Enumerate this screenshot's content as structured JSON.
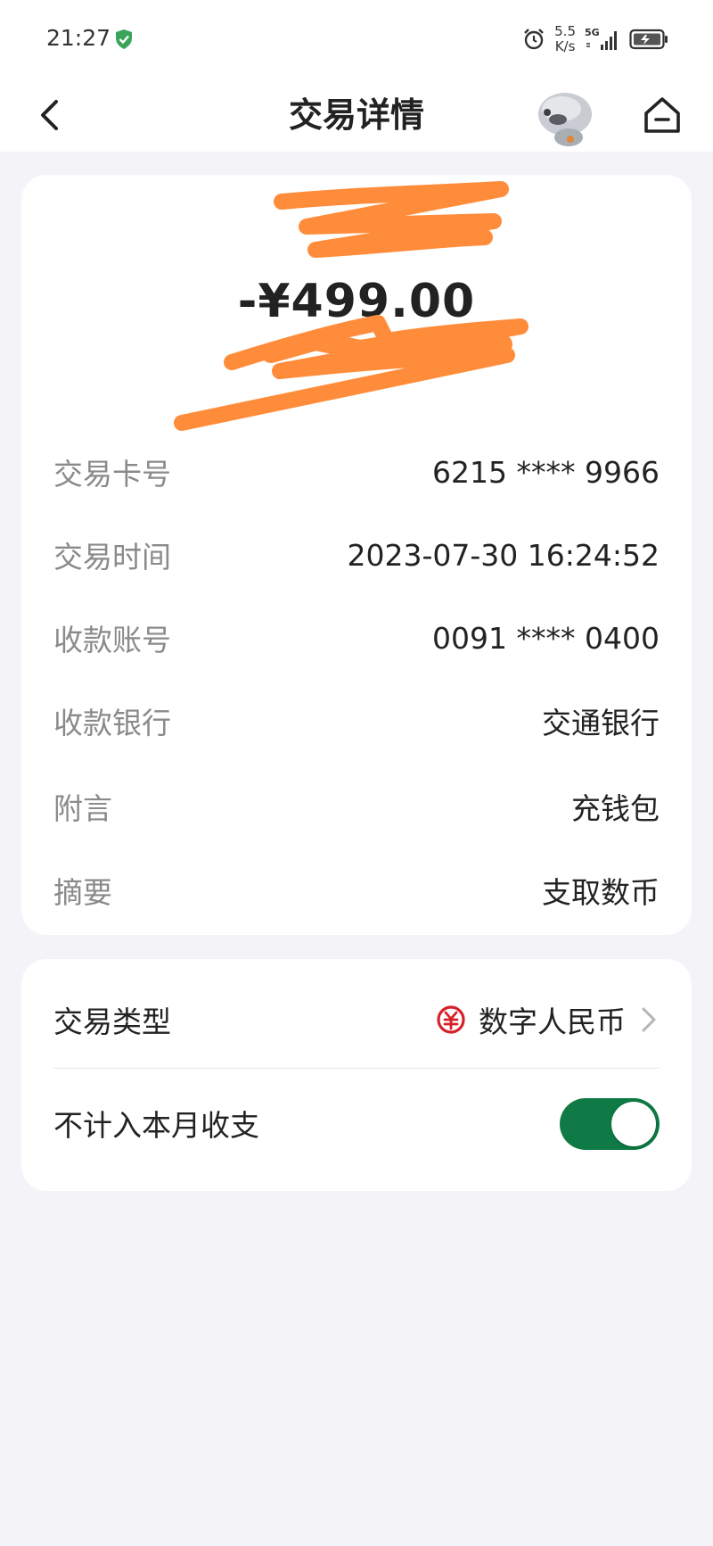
{
  "status_bar": {
    "time": "21:27",
    "net_speed_value": "5.5",
    "net_speed_unit": "K/s",
    "network": "5G"
  },
  "nav": {
    "title": "交易详情",
    "back_icon": "chevron-left-icon",
    "home_icon": "home-icon"
  },
  "transaction": {
    "amount": "-¥499.00",
    "details": [
      {
        "label": "交易卡号",
        "value": "6215 **** 9966"
      },
      {
        "label": "交易时间",
        "value": "2023-07-30 16:24:52"
      },
      {
        "label": "收款账号",
        "value": "0091 **** 0400"
      },
      {
        "label": "收款银行",
        "value": "交通银行"
      },
      {
        "label": "附言",
        "value": "充钱包"
      },
      {
        "label": "摘要",
        "value": "支取数币"
      }
    ]
  },
  "type_card": {
    "type_label": "交易类型",
    "type_value": "数字人民币",
    "exclude_label": "不计入本月收支",
    "exclude_toggle_on": true
  },
  "colors": {
    "accent_green": "#0f7a45",
    "scribble_orange": "#ff8c3a",
    "ecny_red": "#d6202a"
  }
}
